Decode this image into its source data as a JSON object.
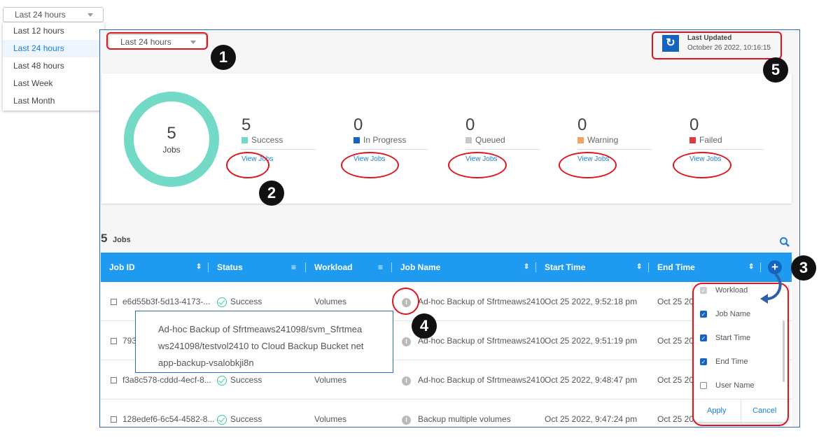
{
  "time_filter": {
    "selected": "Last 24 hours",
    "options": [
      "Last 12 hours",
      "Last 24 hours",
      "Last 48 hours",
      "Last Week",
      "Last Month"
    ]
  },
  "header": {
    "last_updated_label": "Last Updated",
    "last_updated_value": "October 26 2022, 10:16:15",
    "refresh_icon": "refresh-icon"
  },
  "summary": {
    "total": "5",
    "total_label": "Jobs",
    "view_label": "View Jobs",
    "stats": [
      {
        "count": "5",
        "label": "Success",
        "color": "#72dac6"
      },
      {
        "count": "0",
        "label": "In Progress",
        "color": "#1565c0"
      },
      {
        "count": "0",
        "label": "Queued",
        "color": "#c8c8c8"
      },
      {
        "count": "0",
        "label": "Warning",
        "color": "#f4a261"
      },
      {
        "count": "0",
        "label": "Failed",
        "color": "#e03a3e"
      }
    ]
  },
  "table": {
    "count": "5",
    "count_label": "Jobs",
    "columns": [
      "Job ID",
      "Status",
      "Workload",
      "Job Name",
      "Start Time",
      "End Time"
    ],
    "rows": [
      {
        "id": "e6d55b3f-5d13-4173-...",
        "status": "Success",
        "workload": "Volumes",
        "name": "Ad-hoc Backup of Sfrtmeaws2410",
        "start": "Oct 25 2022, 9:52:18 pm",
        "end": "Oct 25 202"
      },
      {
        "id": "793",
        "status": "",
        "workload": "",
        "name": "Ad-hoc Backup of Sfrtmeaws2410",
        "start": "Oct 25 2022, 9:51:19 pm",
        "end": "Oct 25 202"
      },
      {
        "id": "f3a8c578-cddd-4ecf-8...",
        "status": "Success",
        "workload": "Volumes",
        "name": "Ad-hoc Backup of Sfrtmeaws2410",
        "start": "Oct 25 2022, 9:48:47 pm",
        "end": "Oct 25 202"
      },
      {
        "id": "128edef6-6c54-4582-8...",
        "status": "Success",
        "workload": "Volumes",
        "name": "Backup multiple volumes",
        "start": "Oct 25 2022, 9:47:24 pm",
        "end": "Oct 25 202"
      }
    ]
  },
  "tooltip": {
    "lines": [
      "Ad-hoc Backup of Sfrtmeaws241098/svm_Sfrtmea",
      "ws241098/testvol2410 to Cloud Backup Bucket net",
      "app-backup-vsalobkji8n"
    ]
  },
  "column_picker": {
    "options": [
      {
        "label": "Workload",
        "state": "disabled"
      },
      {
        "label": "Job Name",
        "state": "checked"
      },
      {
        "label": "Start Time",
        "state": "checked"
      },
      {
        "label": "End Time",
        "state": "checked"
      },
      {
        "label": "User Name",
        "state": "unchecked"
      }
    ],
    "apply": "Apply",
    "cancel": "Cancel"
  },
  "annotations": [
    "1",
    "2",
    "3",
    "4",
    "5"
  ]
}
